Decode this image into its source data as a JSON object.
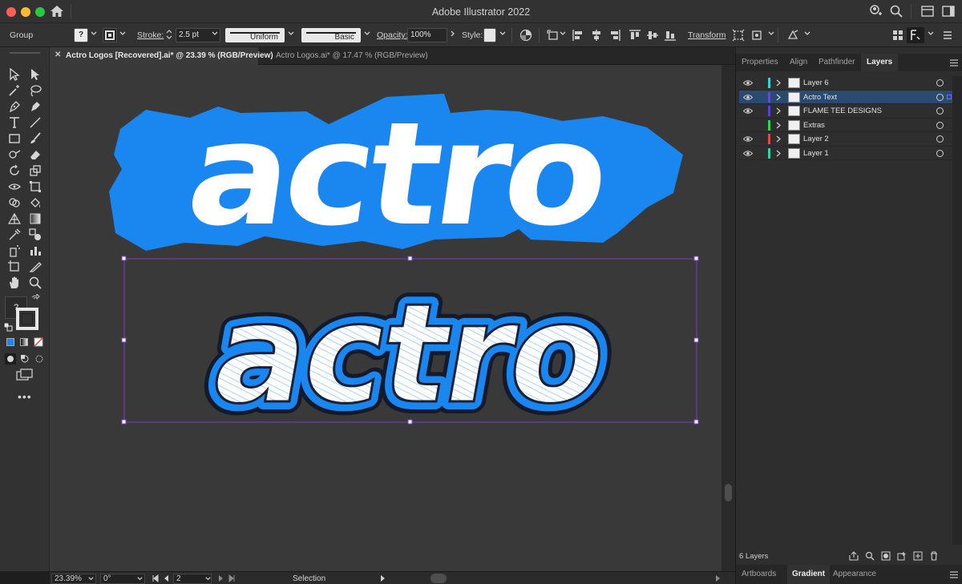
{
  "window": {
    "title": "Adobe Illustrator 2022"
  },
  "control_bar": {
    "selection_type": "Group",
    "stroke_label": "Stroke:",
    "stroke_weight": "2.5 pt",
    "profile": "Uniform",
    "brush": "Basic",
    "opacity_label": "Opacity:",
    "opacity_value": "100%",
    "style_label": "Style:",
    "transform_label": "Transform",
    "stroke_swatch": "?"
  },
  "tabs": [
    {
      "label": "Actro Logos [Recovered].ai* @ 23.39 % (RGB/Preview)",
      "active": true
    },
    {
      "label": "Actro Logos.ai* @ 17.47 % (RGB/Preview)",
      "active": false
    }
  ],
  "toolbar": {
    "fill_indicator": "?"
  },
  "artwork": {
    "logo_top_text": "actro",
    "logo_bottom_text": "actro",
    "brand_blue": "#1a86f0",
    "fill_white": "#ffffff",
    "selection_color": "#7a3fd1"
  },
  "status_bar": {
    "zoom": "23.39%",
    "rotation": "0°",
    "artboard": "2",
    "tool": "Selection"
  },
  "panel": {
    "tabs": [
      "Properties",
      "Align",
      "Pathfinder",
      "Layers"
    ],
    "active_tab": "Layers",
    "layers": [
      {
        "name": "Layer 6",
        "color": "#2fd3d3",
        "visible": true,
        "selected": false
      },
      {
        "name": "Actro Text",
        "color": "#5b4bd6",
        "visible": true,
        "selected": true
      },
      {
        "name": "FLAME TEE DESIGNS",
        "color": "#4e45d8",
        "visible": true,
        "selected": false
      },
      {
        "name": "Extras",
        "color": "#2fd35b",
        "visible": false,
        "selected": false
      },
      {
        "name": "Layer 2",
        "color": "#e24848",
        "visible": true,
        "selected": false
      },
      {
        "name": "Layer 1",
        "color": "#2fd3a8",
        "visible": true,
        "selected": false
      }
    ],
    "layer_count": "6 Layers",
    "bottom_tabs": [
      "Artboards",
      "Gradient",
      "Appearance"
    ],
    "active_bottom_tab": "Gradient"
  }
}
